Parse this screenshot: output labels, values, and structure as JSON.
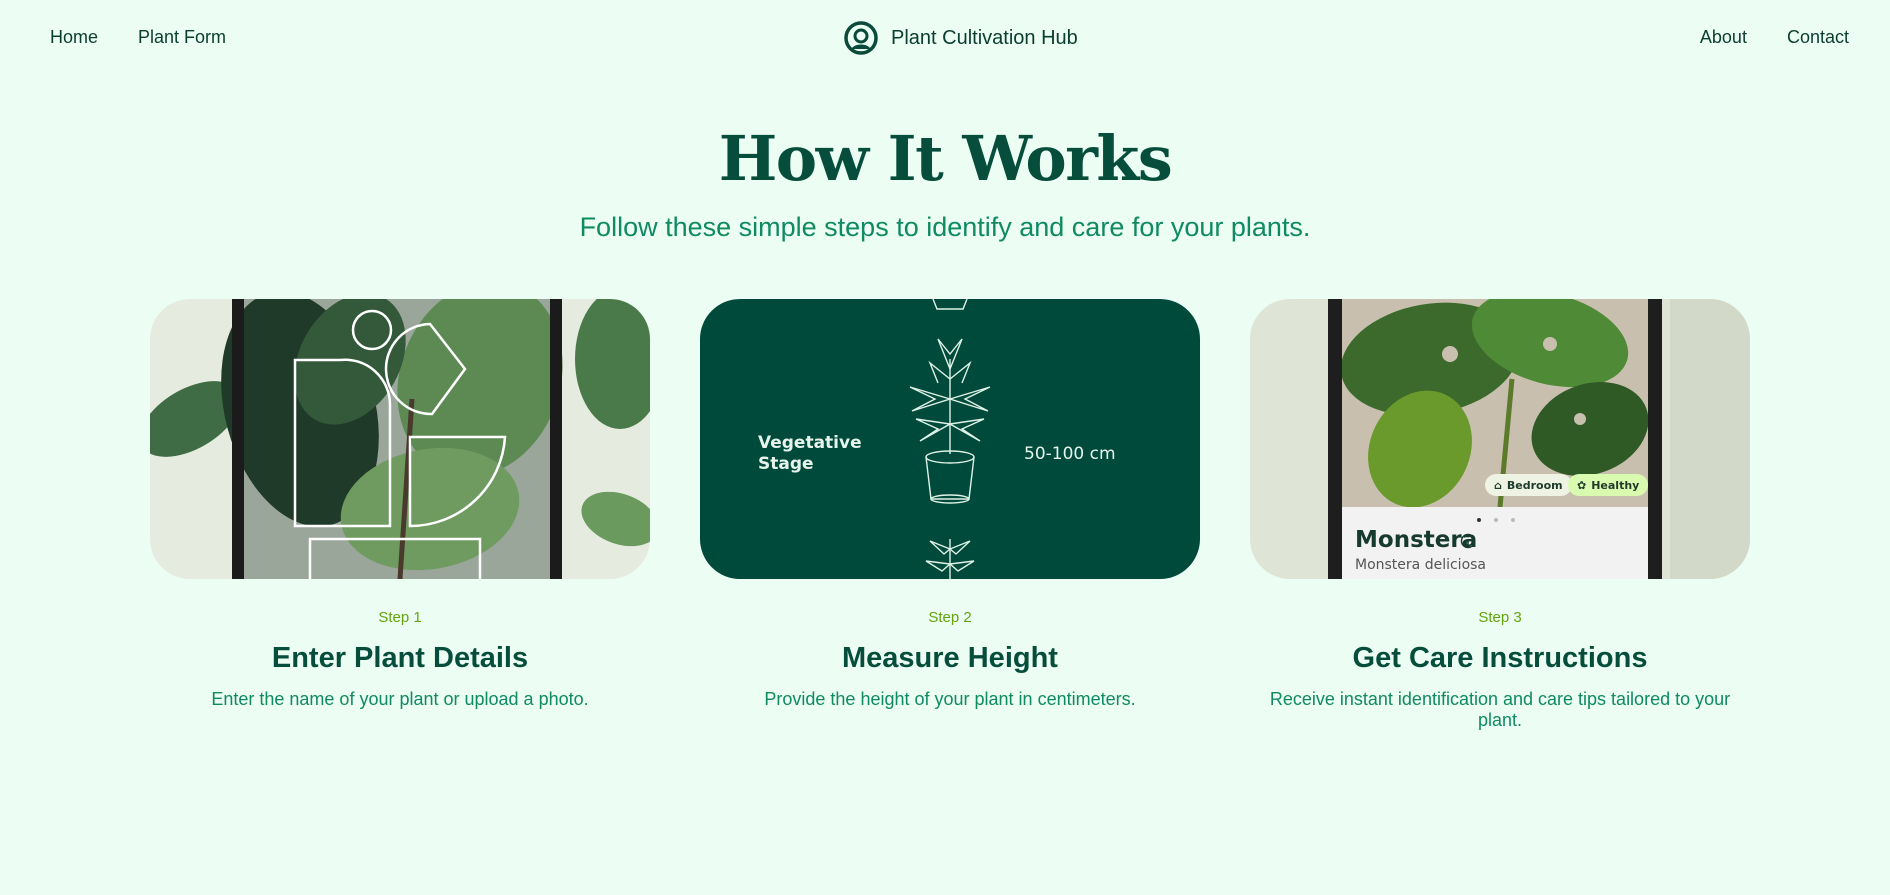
{
  "nav": {
    "left": [
      "Home",
      "Plant Form"
    ],
    "right": [
      "About",
      "Contact"
    ],
    "brand_name": "Plant Cultivation Hub",
    "brand_icon": "plant-logo-icon"
  },
  "hero": {
    "title": "How It Works",
    "subtitle": "Follow these simple steps to identify and care for your plants."
  },
  "steps": [
    {
      "label": "Step 1",
      "title": "Enter Plant Details",
      "description": "Enter the name of your plant or upload a photo."
    },
    {
      "label": "Step 2",
      "title": "Measure Height",
      "description": "Provide the height of your plant in centimeters.",
      "card": {
        "stage": "Vegetative Stage",
        "height": "50-100 cm"
      }
    },
    {
      "label": "Step 3",
      "title": "Get Care Instructions",
      "description": "Receive instant identification and care tips tailored to your plant.",
      "card": {
        "plant_name": "Monstera",
        "scientific_name": "Monstera deliciosa",
        "tags": [
          "Bedroom",
          "Healthy"
        ]
      }
    }
  ],
  "colors": {
    "background": "#ecfdf3",
    "primary": "#064e3b",
    "accent": "#0f8a63",
    "step_label": "#65a30d",
    "card_dark": "#004a3b"
  }
}
